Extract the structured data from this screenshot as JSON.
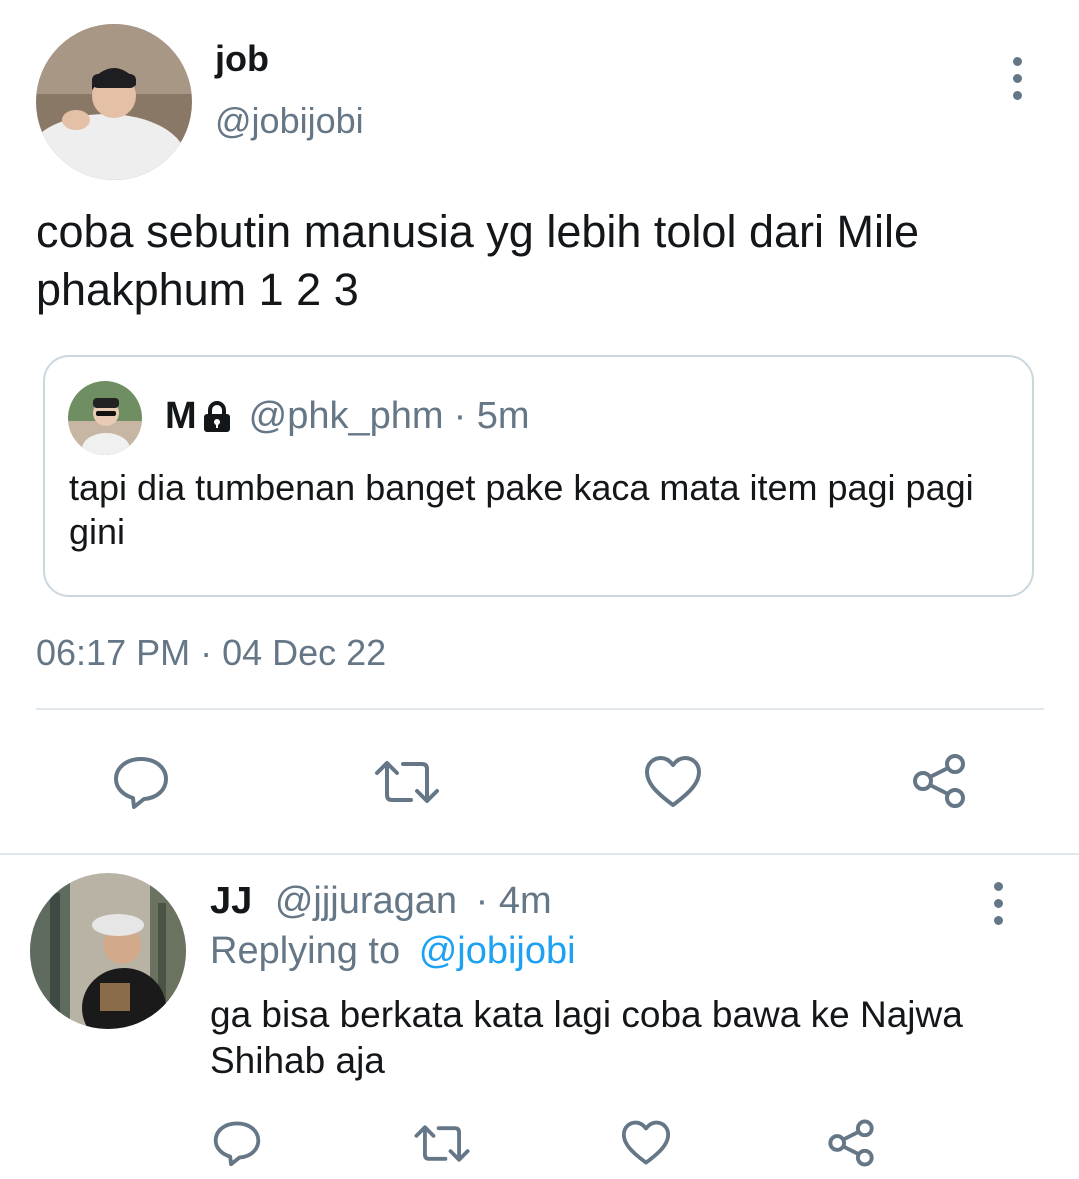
{
  "tweet": {
    "author_name": "job",
    "author_handle": "@jobijobi",
    "text": "coba sebutin manusia yg lebih tolol dari Mile phakphum 1 2 3",
    "timestamp": "06:17 PM · 04 Dec 22"
  },
  "quoted": {
    "author_name": "M",
    "author_handle": "@phk_phm",
    "time": "· 5m",
    "text": "tapi dia tumbenan banget pake kaca mata item pagi pagi gini",
    "protected_icon": "lock-icon"
  },
  "actions": [
    "reply-icon",
    "retweet-icon",
    "like-icon",
    "share-icon"
  ],
  "reply": {
    "author_name": "JJ",
    "author_handle": "@jjjuragan",
    "time": "· 4m",
    "replying_label": "Replying to",
    "replying_handle": "@jobijobi",
    "text": "ga bisa berkata kata lagi coba bawa ke Najwa Shihab aja"
  },
  "colors": {
    "text": "#14171a",
    "secondary": "#657786",
    "link": "#1da1f2",
    "border": "#ccd6dd"
  }
}
